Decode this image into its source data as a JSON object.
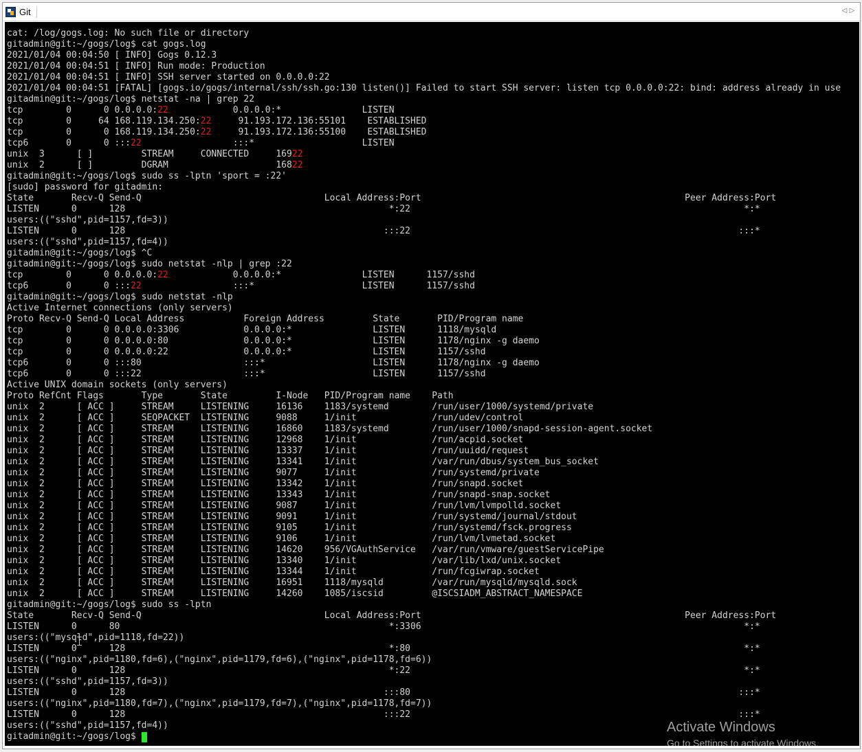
{
  "window": {
    "tab_title": "Git",
    "app_icon": "putty-terminal-icon",
    "scroll_left_icon": "◁",
    "scroll_right_icon": "▷"
  },
  "colors": {
    "terminal_bg": "#000000",
    "terminal_fg": "#d4d4d4",
    "match_highlight": "#e01b1b",
    "cursor": "#2ee62e"
  },
  "terminal": {
    "lines": [
      [
        {
          "t": "cat: /log/gogs.log: No such file or directory"
        }
      ],
      [
        {
          "t": "gitadmin@git:~/gogs/log$ cat gogs.log"
        }
      ],
      [
        {
          "t": "2021/01/04 00:04:50 [ INFO] Gogs 0.12.3"
        }
      ],
      [
        {
          "t": "2021/01/04 00:04:51 [ INFO] Run mode: Production"
        }
      ],
      [
        {
          "t": "2021/01/04 00:04:51 [ INFO] SSH server started on 0.0.0.0:22"
        }
      ],
      [
        {
          "t": "2021/01/04 00:04:51 [FATAL] [gogs.io/gogs/internal/ssh/ssh.go:130 listen()] Failed to start SSH server: listen tcp 0.0.0.0:22: bind: address already in use"
        }
      ],
      [
        {
          "t": "gitadmin@git:~/gogs/log$ netstat -na | grep 22"
        }
      ],
      [
        {
          "t": "tcp        0      0 0.0.0.0:"
        },
        {
          "t": "22",
          "hl": true
        },
        {
          "t": "            0.0.0.0:*               LISTEN"
        }
      ],
      [
        {
          "t": "tcp        0     64 168.119.134.250:"
        },
        {
          "t": "22",
          "hl": true
        },
        {
          "t": "     91.193.172.136:55101    ESTABLISHED"
        }
      ],
      [
        {
          "t": "tcp        0      0 168.119.134.250:"
        },
        {
          "t": "22",
          "hl": true
        },
        {
          "t": "     91.193.172.136:55100    ESTABLISHED"
        }
      ],
      [
        {
          "t": "tcp6       0      0 :::"
        },
        {
          "t": "22",
          "hl": true
        },
        {
          "t": "                 :::*                    LISTEN"
        }
      ],
      [
        {
          "t": "unix  3      [ ]         STREAM     CONNECTED     169"
        },
        {
          "t": "22",
          "hl": true
        }
      ],
      [
        {
          "t": "unix  2      [ ]         DGRAM                    168"
        },
        {
          "t": "22",
          "hl": true
        }
      ],
      [
        {
          "t": "gitadmin@git:~/gogs/log$ sudo ss -lptn 'sport = :22'"
        }
      ],
      [
        {
          "t": "[sudo] password for gitadmin:"
        }
      ],
      [
        {
          "t": "State       Recv-Q Send-Q                                  Local Address:Port                                                 Peer Address:Port"
        }
      ],
      [
        {
          "t": "LISTEN      0      128                                                 *:22                                                              *:*"
        }
      ],
      [
        {
          "t": "users:((\"sshd\",pid=1157,fd=3))"
        }
      ],
      [
        {
          "t": "LISTEN      0      128                                                :::22                                                             :::*"
        }
      ],
      [
        {
          "t": "users:((\"sshd\",pid=1157,fd=4))"
        }
      ],
      [
        {
          "t": "gitadmin@git:~/gogs/log$ ^C"
        }
      ],
      [
        {
          "t": "gitadmin@git:~/gogs/log$ sudo netstat -nlp | grep :22"
        }
      ],
      [
        {
          "t": "tcp        0      0 0.0.0.0:"
        },
        {
          "t": "22",
          "hl": true
        },
        {
          "t": "            0.0.0.0:*               LISTEN      1157/sshd"
        }
      ],
      [
        {
          "t": "tcp6       0      0 :::"
        },
        {
          "t": "22",
          "hl": true
        },
        {
          "t": "                 :::*                    LISTEN      1157/sshd"
        }
      ],
      [
        {
          "t": "gitadmin@git:~/gogs/log$ sudo netstat -nlp"
        }
      ],
      [
        {
          "t": "Active Internet connections (only servers)"
        }
      ],
      [
        {
          "t": "Proto Recv-Q Send-Q Local Address           Foreign Address         State       PID/Program name"
        }
      ],
      [
        {
          "t": "tcp        0      0 0.0.0.0:3306            0.0.0.0:*               LISTEN      1118/mysqld"
        }
      ],
      [
        {
          "t": "tcp        0      0 0.0.0.0:80              0.0.0.0:*               LISTEN      1178/nginx -g daemo"
        }
      ],
      [
        {
          "t": "tcp        0      0 0.0.0.0:22              0.0.0.0:*               LISTEN      1157/sshd"
        }
      ],
      [
        {
          "t": "tcp6       0      0 :::80                   :::*                    LISTEN      1178/nginx -g daemo"
        }
      ],
      [
        {
          "t": "tcp6       0      0 :::22                   :::*                    LISTEN      1157/sshd"
        }
      ],
      [
        {
          "t": "Active UNIX domain sockets (only servers)"
        }
      ],
      [
        {
          "t": "Proto RefCnt Flags       Type       State         I-Node   PID/Program name    Path"
        }
      ],
      [
        {
          "t": "unix  2      [ ACC ]     STREAM     LISTENING     16136    1183/systemd        /run/user/1000/systemd/private"
        }
      ],
      [
        {
          "t": "unix  2      [ ACC ]     SEQPACKET  LISTENING     9088     1/init              /run/udev/control"
        }
      ],
      [
        {
          "t": "unix  2      [ ACC ]     STREAM     LISTENING     16860    1183/systemd        /run/user/1000/snapd-session-agent.socket"
        }
      ],
      [
        {
          "t": "unix  2      [ ACC ]     STREAM     LISTENING     12968    1/init              /run/acpid.socket"
        }
      ],
      [
        {
          "t": "unix  2      [ ACC ]     STREAM     LISTENING     13337    1/init              /run/uuidd/request"
        }
      ],
      [
        {
          "t": "unix  2      [ ACC ]     STREAM     LISTENING     13341    1/init              /var/run/dbus/system_bus_socket"
        }
      ],
      [
        {
          "t": "unix  2      [ ACC ]     STREAM     LISTENING     9077     1/init              /run/systemd/private"
        }
      ],
      [
        {
          "t": "unix  2      [ ACC ]     STREAM     LISTENING     13342    1/init              /run/snapd.socket"
        }
      ],
      [
        {
          "t": "unix  2      [ ACC ]     STREAM     LISTENING     13343    1/init              /run/snapd-snap.socket"
        }
      ],
      [
        {
          "t": "unix  2      [ ACC ]     STREAM     LISTENING     9087     1/init              /run/lvm/lvmpolld.socket"
        }
      ],
      [
        {
          "t": "unix  2      [ ACC ]     STREAM     LISTENING     9091     1/init              /run/systemd/journal/stdout"
        }
      ],
      [
        {
          "t": "unix  2      [ ACC ]     STREAM     LISTENING     9105     1/init              /run/systemd/fsck.progress"
        }
      ],
      [
        {
          "t": "unix  2      [ ACC ]     STREAM     LISTENING     9106     1/init              /run/lvm/lvmetad.socket"
        }
      ],
      [
        {
          "t": "unix  2      [ ACC ]     STREAM     LISTENING     14620    956/VGAuthService   /var/run/vmware/guestServicePipe"
        }
      ],
      [
        {
          "t": "unix  2      [ ACC ]     STREAM     LISTENING     13340    1/init              /var/lib/lxd/unix.socket"
        }
      ],
      [
        {
          "t": "unix  2      [ ACC ]     STREAM     LISTENING     13344    1/init              /run/fcgiwrap.socket"
        }
      ],
      [
        {
          "t": "unix  2      [ ACC ]     STREAM     LISTENING     16951    1118/mysqld         /var/run/mysqld/mysqld.sock"
        }
      ],
      [
        {
          "t": "unix  2      [ ACC ]     STREAM     LISTENING     14260    1085/iscsid         @ISCSIADM_ABSTRACT_NAMESPACE"
        }
      ],
      [
        {
          "t": "gitadmin@git:~/gogs/log$ sudo ss -lptn"
        }
      ],
      [
        {
          "t": "State       Recv-Q Send-Q                                  Local Address:Port                                                 Peer Address:Port"
        }
      ],
      [
        {
          "t": "LISTEN      0      80                                                  *:3306                                                            *:*"
        }
      ],
      [
        {
          "t": "users:((\"mysqld\",pid=1118,fd=22))"
        }
      ],
      [
        {
          "t": "LISTEN      0      128                                                 *:80                                                              *:*"
        }
      ],
      [
        {
          "t": "users:((\"nginx\",pid=1180,fd=6),(\"nginx\",pid=1179,fd=6),(\"nginx\",pid=1178,fd=6))"
        }
      ],
      [
        {
          "t": "LISTEN      0      128                                                 *:22                                                              *:*"
        }
      ],
      [
        {
          "t": "users:((\"sshd\",pid=1157,fd=3))"
        }
      ],
      [
        {
          "t": "LISTEN      0      128                                                :::80                                                             :::*"
        }
      ],
      [
        {
          "t": "users:((\"nginx\",pid=1180,fd=7),(\"nginx\",pid=1179,fd=7),(\"nginx\",pid=1178,fd=7))"
        }
      ],
      [
        {
          "t": "LISTEN      0      128                                                :::22                                                             :::*"
        }
      ],
      [
        {
          "t": "users:((\"sshd\",pid=1157,fd=4))"
        }
      ]
    ],
    "prompt": "gitadmin@git:~/gogs/log$ "
  },
  "watermark": {
    "title": "Activate Windows",
    "subtitle": "Go to Settings to activate Windows."
  }
}
